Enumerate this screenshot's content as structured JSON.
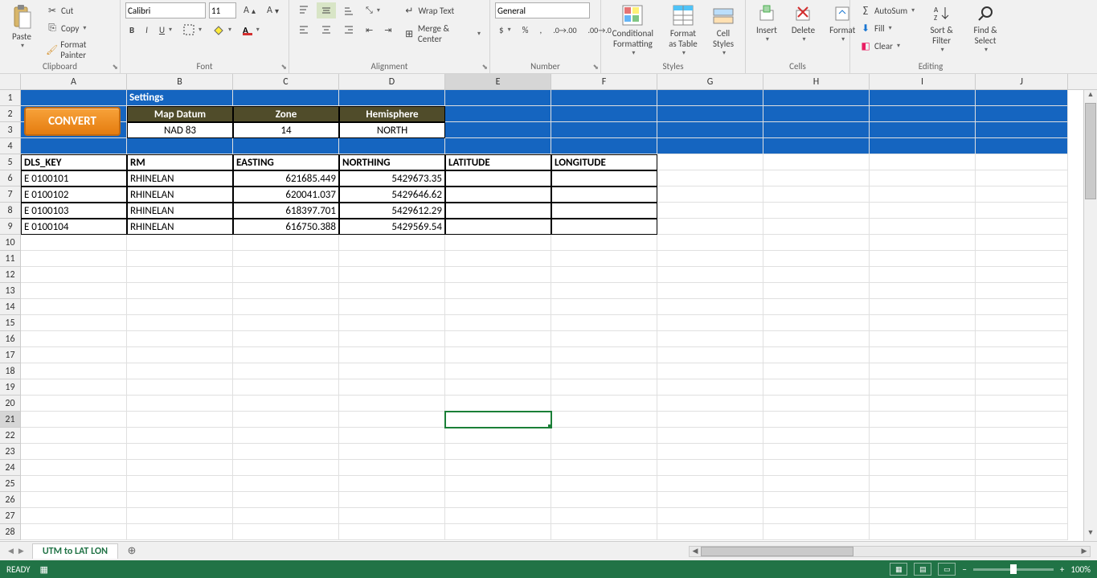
{
  "ribbon": {
    "clipboard": {
      "paste": "Paste",
      "cut": "Cut",
      "copy": "Copy",
      "fmtpainter": "Format Painter",
      "group": "Clipboard"
    },
    "font": {
      "family": "Calibri",
      "size": "11",
      "group": "Font"
    },
    "alignment": {
      "wrap": "Wrap Text",
      "merge": "Merge & Center",
      "group": "Alignment"
    },
    "number": {
      "format": "General",
      "group": "Number"
    },
    "styles": {
      "cond": "Conditional Formatting",
      "table": "Format as Table",
      "cells": "Cell Styles",
      "group": "Styles"
    },
    "cells": {
      "insert": "Insert",
      "delete": "Delete",
      "format": "Format",
      "group": "Cells"
    },
    "editing": {
      "autosum": "AutoSum",
      "fill": "Fill",
      "clear": "Clear",
      "sort": "Sort & Filter",
      "find": "Find & Select",
      "group": "Editing"
    }
  },
  "columns": [
    "A",
    "B",
    "C",
    "D",
    "E",
    "F",
    "G",
    "H",
    "I",
    "J"
  ],
  "activeCol": "E",
  "activeRow": 21,
  "settings": {
    "label": "Settings",
    "convert": "CONVERT",
    "headers": [
      "Map Datum",
      "Zone",
      "Hemisphere"
    ],
    "values": [
      "NAD 83",
      "14",
      "NORTH"
    ]
  },
  "dataHeaders": [
    "DLS_KEY",
    "RM",
    "EASTING",
    "NORTHING",
    "LATITUDE",
    "LONGITUDE"
  ],
  "dataRows": [
    {
      "dls": "E 0100101",
      "rm": "RHINELAN",
      "easting": "621685.449",
      "northing": "5429673.35",
      "lat": "",
      "lon": ""
    },
    {
      "dls": "E 0100102",
      "rm": "RHINELAN",
      "easting": "620041.037",
      "northing": "5429646.62",
      "lat": "",
      "lon": ""
    },
    {
      "dls": "E 0100103",
      "rm": "RHINELAN",
      "easting": "618397.701",
      "northing": "5429612.29",
      "lat": "",
      "lon": ""
    },
    {
      "dls": "E 0100104",
      "rm": "RHINELAN",
      "easting": "616750.388",
      "northing": "5429569.54",
      "lat": "",
      "lon": ""
    }
  ],
  "sheetTab": "UTM to LAT LON",
  "status": {
    "ready": "READY",
    "zoom": "100%"
  }
}
